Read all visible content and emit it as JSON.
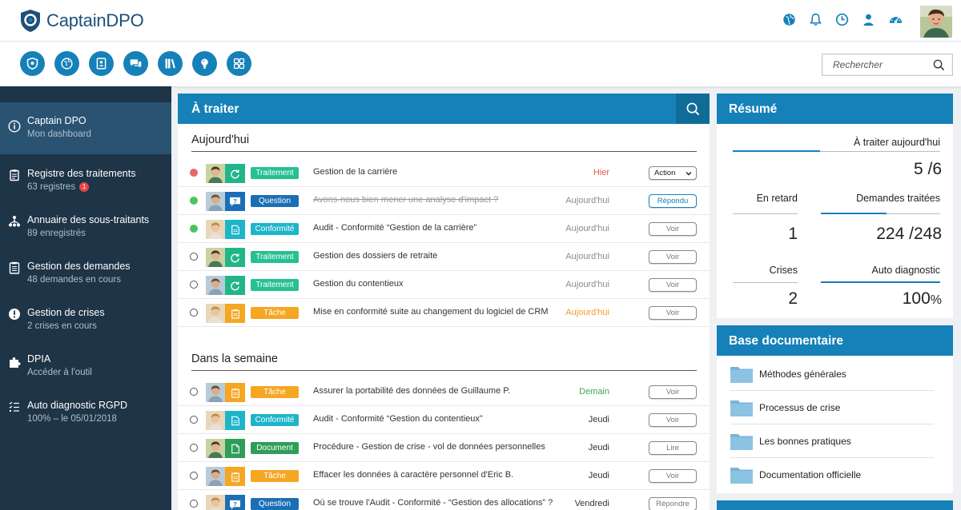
{
  "app": {
    "name": "CaptainDPO"
  },
  "colors": {
    "primary": "#1581b8",
    "sidebar": "#1e3447",
    "sidebar_active": "#2a5371"
  },
  "header": {
    "icons": [
      "globe-icon",
      "bell-icon",
      "clock-icon",
      "user-icon",
      "dashboard-gauge-icon"
    ]
  },
  "toolbar": {
    "apps": [
      "shield-icon",
      "globe-icon",
      "contacts-book-icon",
      "chat-bubbles-icon",
      "books-icon",
      "lightbulb-icon",
      "grid-icon"
    ]
  },
  "search": {
    "placeholder": "Rechercher"
  },
  "sidebar": {
    "items": [
      {
        "title": "Captain DPO",
        "subtitle": "Mon dashboard",
        "icon": "info-icon",
        "active": true
      },
      {
        "title": "Registre des traitements",
        "subtitle": "63 registres",
        "icon": "clipboard-icon",
        "badge": "1"
      },
      {
        "title": "Annuaire des sous-traitants",
        "subtitle": "89 enregistrés",
        "icon": "org-chart-icon"
      },
      {
        "title": "Gestion des demandes",
        "subtitle": "48 demandes en cours",
        "icon": "list-clipboard-icon"
      },
      {
        "title": "Gestion de crises",
        "subtitle": "2 crises en cours",
        "icon": "alert-icon"
      },
      {
        "title": "DPIA",
        "subtitle": "Accéder à l'outil",
        "icon": "puzzle-icon"
      },
      {
        "title": "Auto diagnostic RGPD",
        "subtitle": "100% – le 05/01/2018",
        "icon": "checklist-icon"
      }
    ]
  },
  "todo": {
    "title": "À traiter",
    "today_title": "Aujourd'hui",
    "week_title": "Dans la semaine",
    "today": [
      {
        "status": "red",
        "tag": "Traitement",
        "title": "Gestion de la carrière",
        "when": "Hier",
        "when_color": "red",
        "action": "Action"
      },
      {
        "status": "green",
        "tag": "Question",
        "title": "Avons-nous bien mener une analyse d'impact ?",
        "struck": true,
        "when": "Aujourd'hui",
        "action": "Répondu"
      },
      {
        "status": "green",
        "tag": "Conformité",
        "title": "Audit - Conformité  “Gestion de la carrière”",
        "when": "Aujourd'hui",
        "action": "Voir"
      },
      {
        "status": "empty",
        "tag": "Traitement",
        "title": "Gestion des dossiers de retraite",
        "when": "Aujourd'hui",
        "action": "Voir"
      },
      {
        "status": "empty",
        "tag": "Traitement",
        "title": "Gestion du contentieux",
        "when": "Aujourd'hui",
        "action": "Voir"
      },
      {
        "status": "empty",
        "tag": "Tâche",
        "title": "Mise en conformité suite au changement du logiciel de CRM",
        "when": "Aujourd'hui",
        "when_color": "orange",
        "action": "Voir"
      }
    ],
    "week": [
      {
        "status": "empty",
        "tag": "Tâche",
        "title": "Assurer la portabilité des données de Guillaume P.",
        "when": "Demain",
        "when_color": "green",
        "action": "Voir"
      },
      {
        "status": "empty",
        "tag": "Conformité",
        "title": "Audit - Conformité  “Gestion du contentieux”",
        "when": "Jeudi",
        "when_color": "dark",
        "action": "Voir"
      },
      {
        "status": "empty",
        "tag": "Document",
        "title": "Procédure - Gestion de crise - vol de données personnelles",
        "when": "Jeudi",
        "when_color": "dark",
        "action": "Lire"
      },
      {
        "status": "empty",
        "tag": "Tâche",
        "title": "Effacer les données à caractère personnel d'Eric B.",
        "when": "Jeudi",
        "when_color": "dark",
        "action": "Voir"
      },
      {
        "status": "empty",
        "tag": "Question",
        "title": "Où se trouve l'Audit - Conformité - “Gestion des allocations” ?",
        "when": "Vendredi",
        "when_color": "dark",
        "action": "Répondre"
      }
    ]
  },
  "summary": {
    "title": "Résumé",
    "stats": {
      "today": {
        "label": "À traiter aujourd'hui",
        "value": "5 /6",
        "progress": 0.42
      },
      "late": {
        "label": "En retard",
        "value": "1",
        "progress": 0
      },
      "done": {
        "label": "Demandes traitées",
        "value": "224 /248",
        "progress": 0.55
      },
      "crises": {
        "label": "Crises",
        "value": "2",
        "progress": 0
      },
      "auto": {
        "label": "Auto diagnostic",
        "value": "100",
        "unit": "%",
        "progress": 1.0
      }
    }
  },
  "docs": {
    "title": "Base documentaire",
    "items": [
      "Méthodes générales",
      "Processus de crise",
      "Les bonnes pratiques",
      "Documentation officielle"
    ]
  }
}
